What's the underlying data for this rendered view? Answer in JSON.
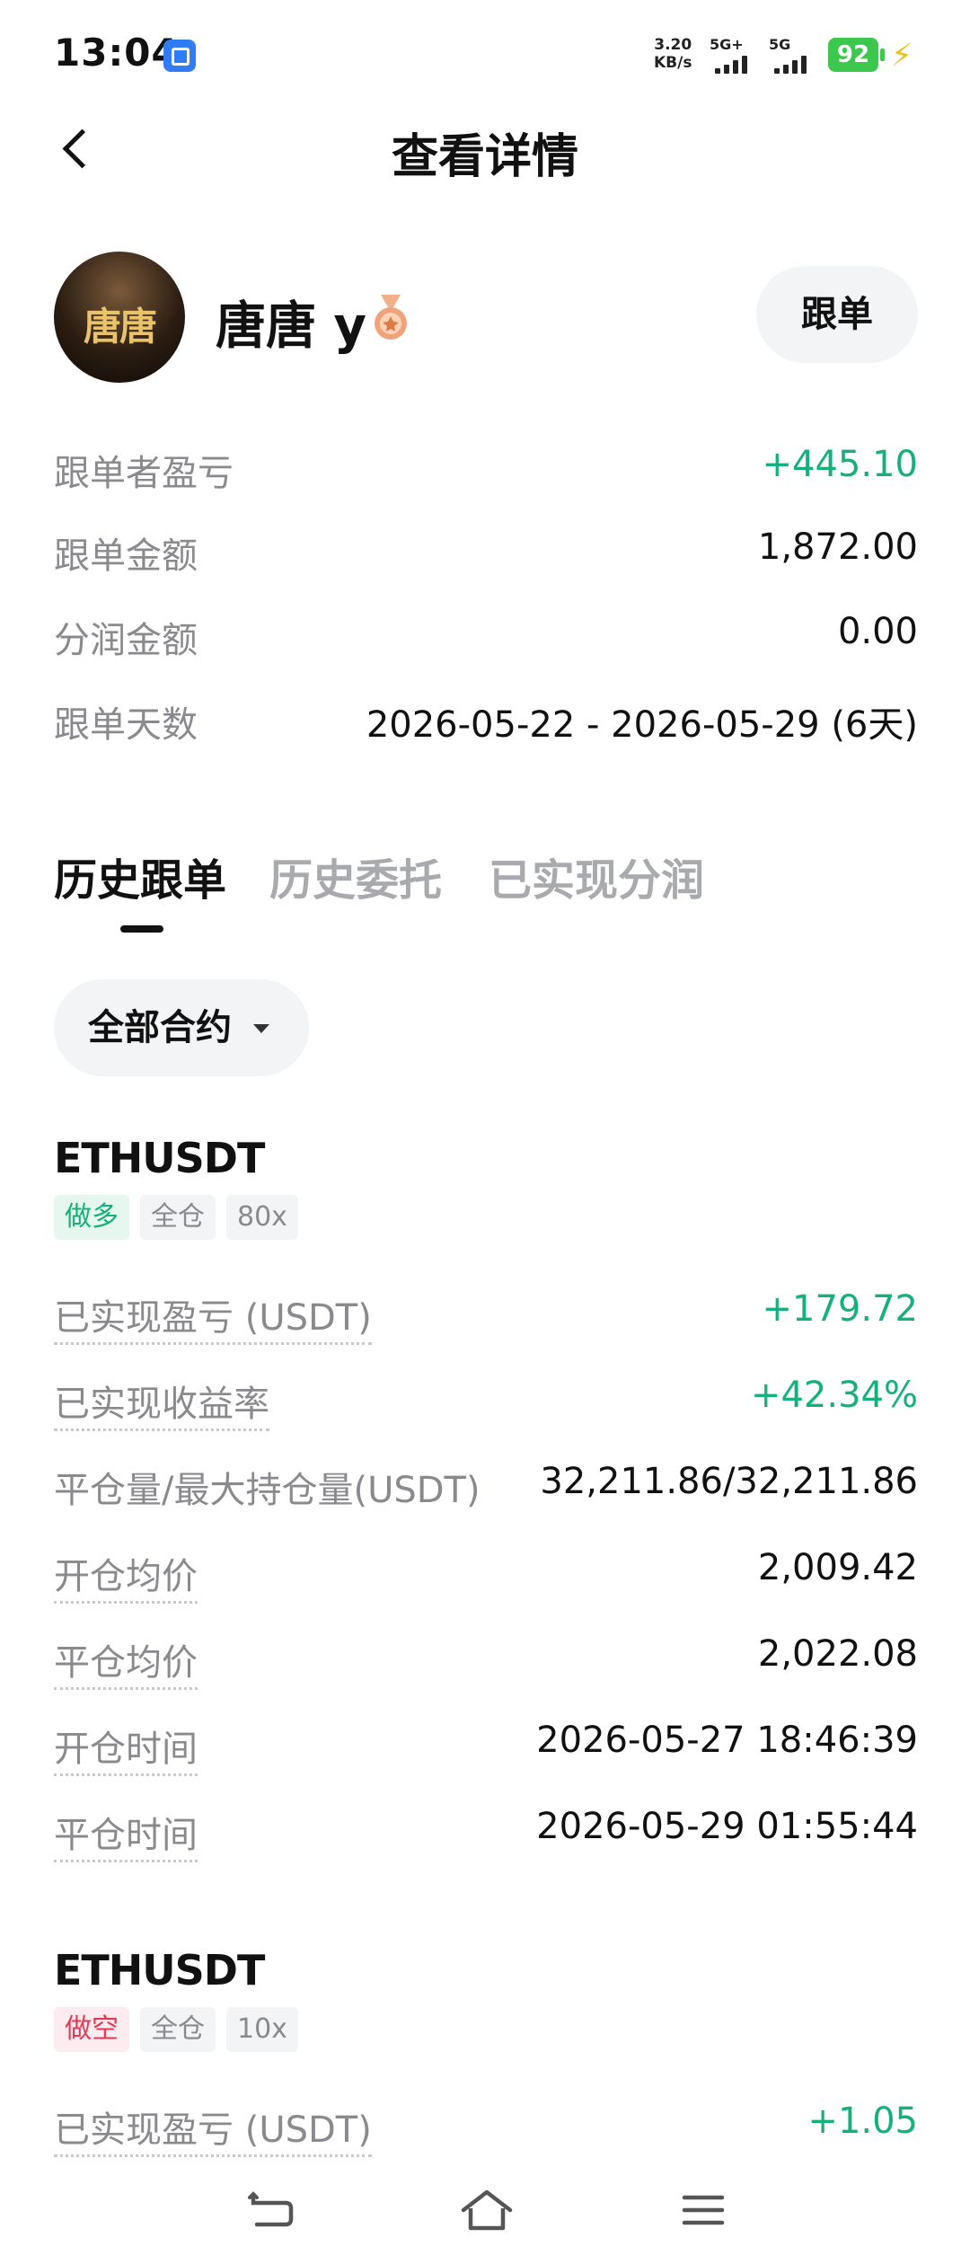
{
  "status": {
    "time": "13:04",
    "net_speed_value": "3.20",
    "net_speed_unit": "KB/s",
    "sig1_label": "5G+",
    "sig2_label": "5G",
    "battery": "92"
  },
  "header": {
    "title": "查看详情"
  },
  "trader": {
    "name": "唐唐 y",
    "avatar_text": "唐唐",
    "follow_label": "跟单"
  },
  "summary": [
    {
      "label": "跟单者盈亏",
      "value": "+445.10",
      "positive": true
    },
    {
      "label": "跟单金额",
      "value": "1,872.00"
    },
    {
      "label": "分润金额",
      "value": "0.00"
    },
    {
      "label": "跟单天数",
      "value": "2026-05-22 - 2026-05-29 (6天)"
    }
  ],
  "tabs": [
    {
      "label": "历史跟单",
      "active": true
    },
    {
      "label": "历史委托"
    },
    {
      "label": "已实现分润"
    }
  ],
  "filter": {
    "label": "全部合约"
  },
  "orders": [
    {
      "symbol": "ETHUSDT",
      "tags": [
        "做多",
        "全仓",
        "80x"
      ],
      "rows": [
        {
          "label": "已实现盈亏 (USDT)",
          "value": "+179.72"
        },
        {
          "label": "已实现收益率",
          "value": "+42.34%"
        },
        {
          "label": "平仓量/最大持仓量(USDT)",
          "value": "32,211.86/32,211.86"
        },
        {
          "label": "开仓均价",
          "value": "2,009.42"
        },
        {
          "label": "平仓均价",
          "value": "2,022.08"
        },
        {
          "label": "开仓时间",
          "value": "2026-05-27 18:46:39"
        },
        {
          "label": "平仓时间",
          "value": "2026-05-29 01:55:44"
        }
      ]
    },
    {
      "symbol": "ETHUSDT",
      "tags": [
        "做空",
        "全仓",
        "10x"
      ],
      "rows": [
        {
          "label": "已实现盈亏 (USDT)",
          "value": "+1.05"
        }
      ]
    }
  ],
  "colors": {
    "positive": "#16b17a",
    "negative": "#e23a55",
    "muted": "#8a8a8e"
  }
}
